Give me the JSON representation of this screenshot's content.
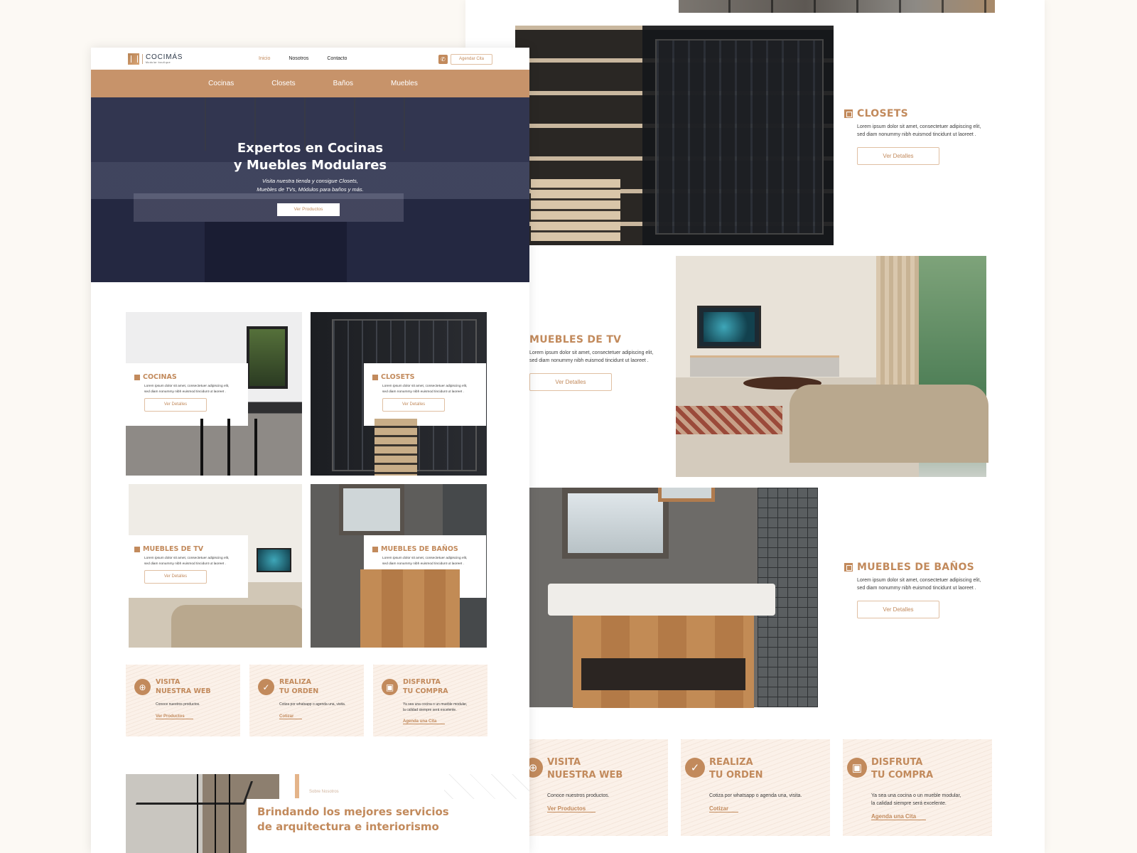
{
  "brand": {
    "name": "COCIMÁS",
    "tagline": "Modular boutique",
    "accent_color": "#c28a5c",
    "nav_bar_color": "#c7936a"
  },
  "header": {
    "nav": [
      {
        "label": "Inicio",
        "active": true
      },
      {
        "label": "Nosotros",
        "active": false
      },
      {
        "label": "Contacto",
        "active": false
      }
    ],
    "whatsapp_icon": "whatsapp-icon",
    "cta_label": "Agendar Cita"
  },
  "category_nav": [
    "Cocinas",
    "Closets",
    "Baños",
    "Muebles"
  ],
  "hero": {
    "title_line1": "Expertos en Cocinas",
    "title_line2": "y Muebles Modulares",
    "subtitle_line1": "Visita nuestra tienda y consigue Closets,",
    "subtitle_line2": "Muebles de TVs, Módulos para baños y más.",
    "button_label": "Ver Productos"
  },
  "products": [
    {
      "title": "COCINAS",
      "icon": "kitchen-icon",
      "desc_line1": "Lorem ipsum dolor sit amet, consectetuer adipiscing elit,",
      "desc_line2": "sed diam nonummy nibh euismod tincidunt ut laoreet .",
      "button": "Ver Detalles"
    },
    {
      "title": "CLOSETS",
      "icon": "closet-icon",
      "desc_line1": "Lorem ipsum dolor sit amet, consectetuer adipiscing elit,",
      "desc_line2": "sed diam nonummy nibh euismod tincidunt ut laoreet .",
      "button": "Ver Detalles"
    },
    {
      "title": "MUEBLES DE TV",
      "icon": "tv-furniture-icon",
      "desc_line1": "Lorem ipsum dolor sit amet, consectetuer adipiscing elit,",
      "desc_line2": "sed diam nonummy nibh euismod tincidunt ut laoreet .",
      "button": "Ver Detalles"
    },
    {
      "title": "MUEBLES DE BAÑOS",
      "icon": "bathroom-icon",
      "desc_line1": "Lorem ipsum dolor sit amet, consectetuer adipiscing elit,",
      "desc_line2": "sed diam nonummy nibh euismod tincidunt ut laoreet .",
      "button": "Ver Detalles"
    }
  ],
  "steps": [
    {
      "title_line1": "VISITA",
      "title_line2": "NUESTRA WEB",
      "icon": "globe-icon",
      "desc_line1": "Conoce nuestros productos.",
      "desc_line2": "",
      "link": "Ver Productos"
    },
    {
      "title_line1": "REALIZA",
      "title_line2": "TU ORDEN",
      "icon": "shopping-bag-check-icon",
      "desc_line1": "Cotiza por whatsapp o agenda una, visita.",
      "desc_line2": "",
      "link": "Cotizar"
    },
    {
      "title_line1": "DISFRUTA",
      "title_line2": "TU COMPRA",
      "icon": "delivery-truck-icon",
      "desc_line1": "Ya sea una cocina o un mueble modular,",
      "desc_line2": "la calidad siempre será excelente.",
      "link": "Agenda una Cita"
    }
  ],
  "about": {
    "label": "Sobre Nosotros",
    "title_line1": "Brindando los mejores servicios",
    "title_line2": "de arquitectura e interiorismo"
  }
}
